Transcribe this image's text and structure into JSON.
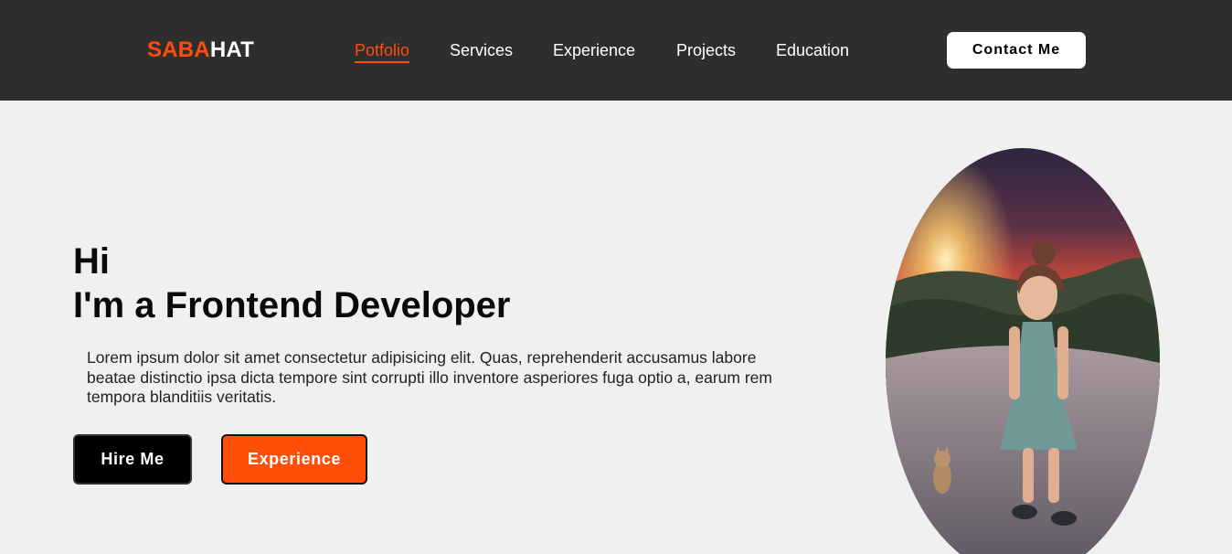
{
  "header": {
    "logo_part1": "SABA",
    "logo_part2": "HAT",
    "nav": [
      {
        "label": "Potfolio",
        "active": true
      },
      {
        "label": "Services"
      },
      {
        "label": "Experience"
      },
      {
        "label": "Projects"
      },
      {
        "label": "Education"
      }
    ],
    "contact_label": "Contact Me"
  },
  "hero": {
    "line1": "Hi",
    "line2": "I'm a Frontend Developer",
    "description": "Lorem ipsum dolor sit amet consectetur adipisicing elit. Quas, reprehenderit accusamus labore beatae distinctio ipsa dicta tempore sint corrupti illo inventore asperiores fuga optio a, earum rem tempora blanditiis veritatis.",
    "hire_label": "Hire Me",
    "experience_label": "Experience"
  },
  "colors": {
    "accent": "#ff4d0a",
    "nav_background": "#2e2e2e",
    "page_background": "#f0f0f0"
  },
  "images": {
    "portrait": "portrait-photo-girl-in-dress-with-kitten-at-sunset"
  }
}
